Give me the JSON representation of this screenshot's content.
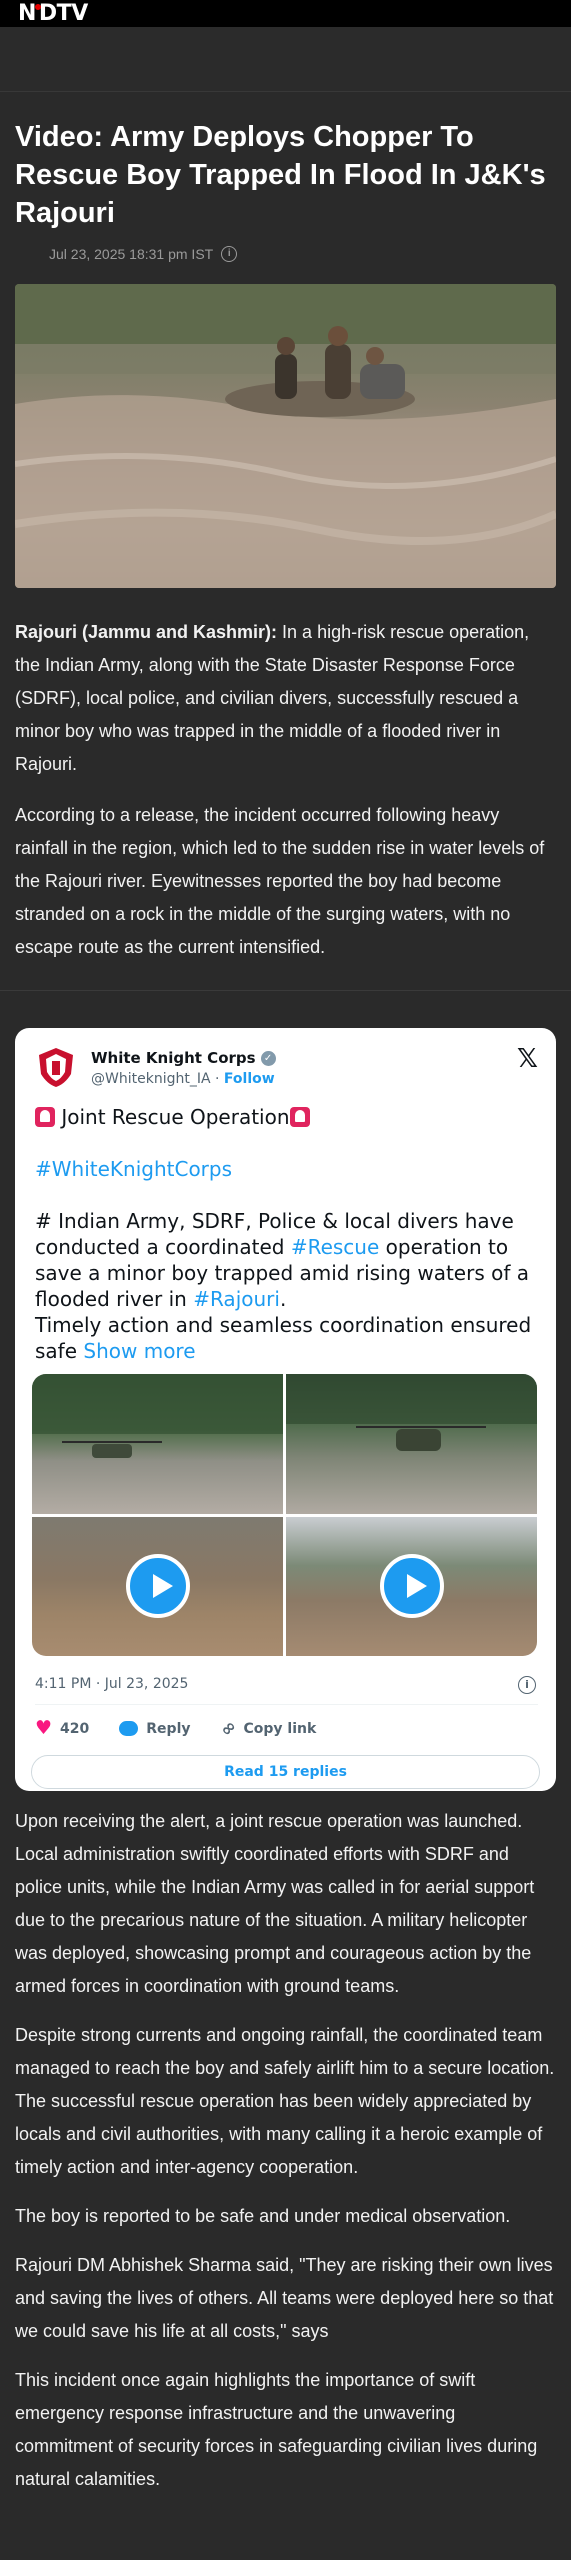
{
  "site": {
    "logo": "NDTV"
  },
  "article": {
    "headline": "Video: Army Deploys Chopper To Rescue Boy Trapped In Flood In J&K's Rajouri",
    "dateline": "Jul 23, 2025 18:31 pm IST",
    "lead_place": "Rajouri (Jammu and Kashmir):",
    "p1": " In a high-risk rescue operation, the Indian Army, along with the State Disaster Response Force (SDRF), local police, and civilian divers, successfully rescued a minor boy who was trapped in the middle of a flooded river in Rajouri.",
    "p2": "According to a release, the incident occurred following heavy rainfall in the region, which led to the sudden rise in water levels of the Rajouri river. Eyewitnesses reported the boy had become stranded on a rock in the middle of the surging waters, with no escape route as the current intensified.",
    "p3": "Upon receiving the alert, a joint rescue operation was launched. Local administration swiftly coordinated efforts with SDRF and police units, while the Indian Army was called in for aerial support due to the precarious nature of the situation. A military helicopter was deployed, showcasing prompt and courageous action by the armed forces in coordination with ground teams.",
    "p4": "Despite strong currents and ongoing rainfall, the coordinated team managed to reach the boy and safely airlift him to a secure location. The successful rescue operation has been widely appreciated by locals and civil authorities, with many calling it a heroic example of timely action and inter-agency cooperation.",
    "p5": "The boy is reported to be safe and under medical observation.",
    "p6": "Rajouri DM Abhishek Sharma said, \"They are risking their own lives and saving the lives of others. All teams were deployed here so that we could save his life at all costs,\" says",
    "p7": "This incident once again highlights the importance of swift emergency response infrastructure and the unwavering commitment of security forces in safeguarding civilian lives during natural calamities."
  },
  "tweet": {
    "name": "White Knight Corps",
    "handle": "@Whiteknight_IA",
    "separator": " · ",
    "follow": "Follow",
    "title": " Joint Rescue Operation",
    "hashtag1": "#WhiteKnightCorps",
    "body_a": "# Indian Army, SDRF, Police & local divers have conducted a coordinated ",
    "hashtag2": "#Rescue",
    "body_b": " operation to save a minor boy trapped amid rising waters of a flooded river in ",
    "hashtag3": "#Rajouri",
    "body_c": ".",
    "body_d": "Timely action and seamless coordination ensured safe ",
    "show_more": "Show more",
    "timestamp": "4:11 PM · Jul 23, 2025",
    "likes": "420",
    "reply_label": "Reply",
    "copy_link_label": "Copy link",
    "read_replies": "Read 15 replies"
  },
  "icons": {
    "verified": "verified-badge-icon",
    "x": "x-logo-icon",
    "info": "info-icon",
    "heart": "heart-icon",
    "reply": "reply-bubble-icon",
    "link": "link-icon",
    "play": "play-icon",
    "siren": "siren-emoji-icon"
  },
  "colors": {
    "background": "#2a2a2a",
    "accent_link": "#1d9bf0",
    "like": "#f91880",
    "brand_red": "#e60000"
  }
}
